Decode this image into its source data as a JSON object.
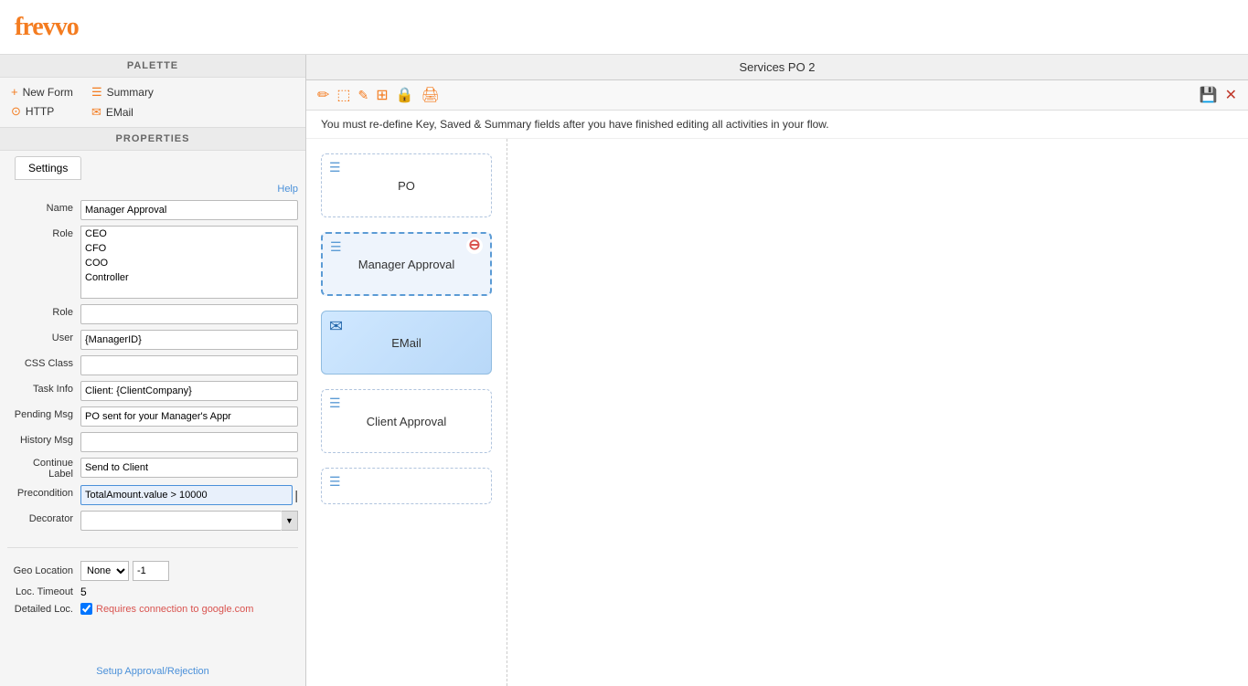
{
  "header": {
    "logo": "fre✓✓o"
  },
  "palette": {
    "header": "PALETTE",
    "items_left": [
      {
        "id": "new-form",
        "label": "New Form",
        "icon": "+"
      },
      {
        "id": "http",
        "label": "HTTP",
        "icon": "⊙"
      }
    ],
    "items_right": [
      {
        "id": "summary",
        "label": "Summary",
        "icon": "☰"
      },
      {
        "id": "email",
        "label": "EMail",
        "icon": "✉"
      }
    ]
  },
  "properties": {
    "header": "PROPERTIES",
    "tab": "Settings",
    "help_label": "Help",
    "fields": {
      "name_label": "Name",
      "name_value": "Manager Approval",
      "role_label": "Role",
      "role_options": [
        "CEO",
        "CFO",
        "COO",
        "Controller"
      ],
      "role2_label": "Role",
      "role2_value": "",
      "user_label": "User",
      "user_value": "{ManagerID}",
      "css_label": "CSS Class",
      "css_value": "",
      "task_label": "Task Info",
      "task_value": "Client: {ClientCompany}",
      "pending_label": "Pending Msg",
      "pending_value": "PO sent for your Manager's Appr",
      "history_label": "History Msg",
      "history_value": "",
      "continue_label": "Continue",
      "continue_label2": "Label",
      "continue_value": "Send to Client",
      "precondition_label": "Precondition",
      "precondition_value": "TotalAmount.value > 10000",
      "decorator_label": "Decorator",
      "decorator_value": ""
    },
    "geo": {
      "geo_location_label": "Geo Location",
      "geo_location_value": "None",
      "geo_number": "-1",
      "loc_timeout_label": "Loc. Timeout",
      "loc_timeout_value": "5",
      "detailed_loc_label": "Detailed Loc.",
      "detailed_loc_checked": true,
      "requires_text": "Requires connection to google.com"
    },
    "setup_approval": "Setup Approval/Rejection"
  },
  "right": {
    "title": "Services PO 2",
    "warning": "You must re-define Key, Saved & Summary fields after you have finished editing all activities in your flow.",
    "toolbar_icons": [
      "✏",
      "📋",
      "✎",
      "⊞",
      "🔒",
      "🖨"
    ],
    "toolbar_right_icons": [
      "💾",
      "✕"
    ],
    "cards": [
      {
        "id": "po",
        "label": "PO",
        "icon": "☰",
        "active": false,
        "email": false
      },
      {
        "id": "manager-approval",
        "label": "Manager Approval",
        "icon": "☰",
        "active": true,
        "email": false,
        "has_minus": true
      },
      {
        "id": "email",
        "label": "EMail",
        "icon": "✉",
        "active": false,
        "email": true
      },
      {
        "id": "client-approval",
        "label": "Client Approval",
        "icon": "☰",
        "active": false,
        "email": false
      },
      {
        "id": "more",
        "label": "",
        "icon": "☰",
        "active": false,
        "email": false
      }
    ]
  }
}
